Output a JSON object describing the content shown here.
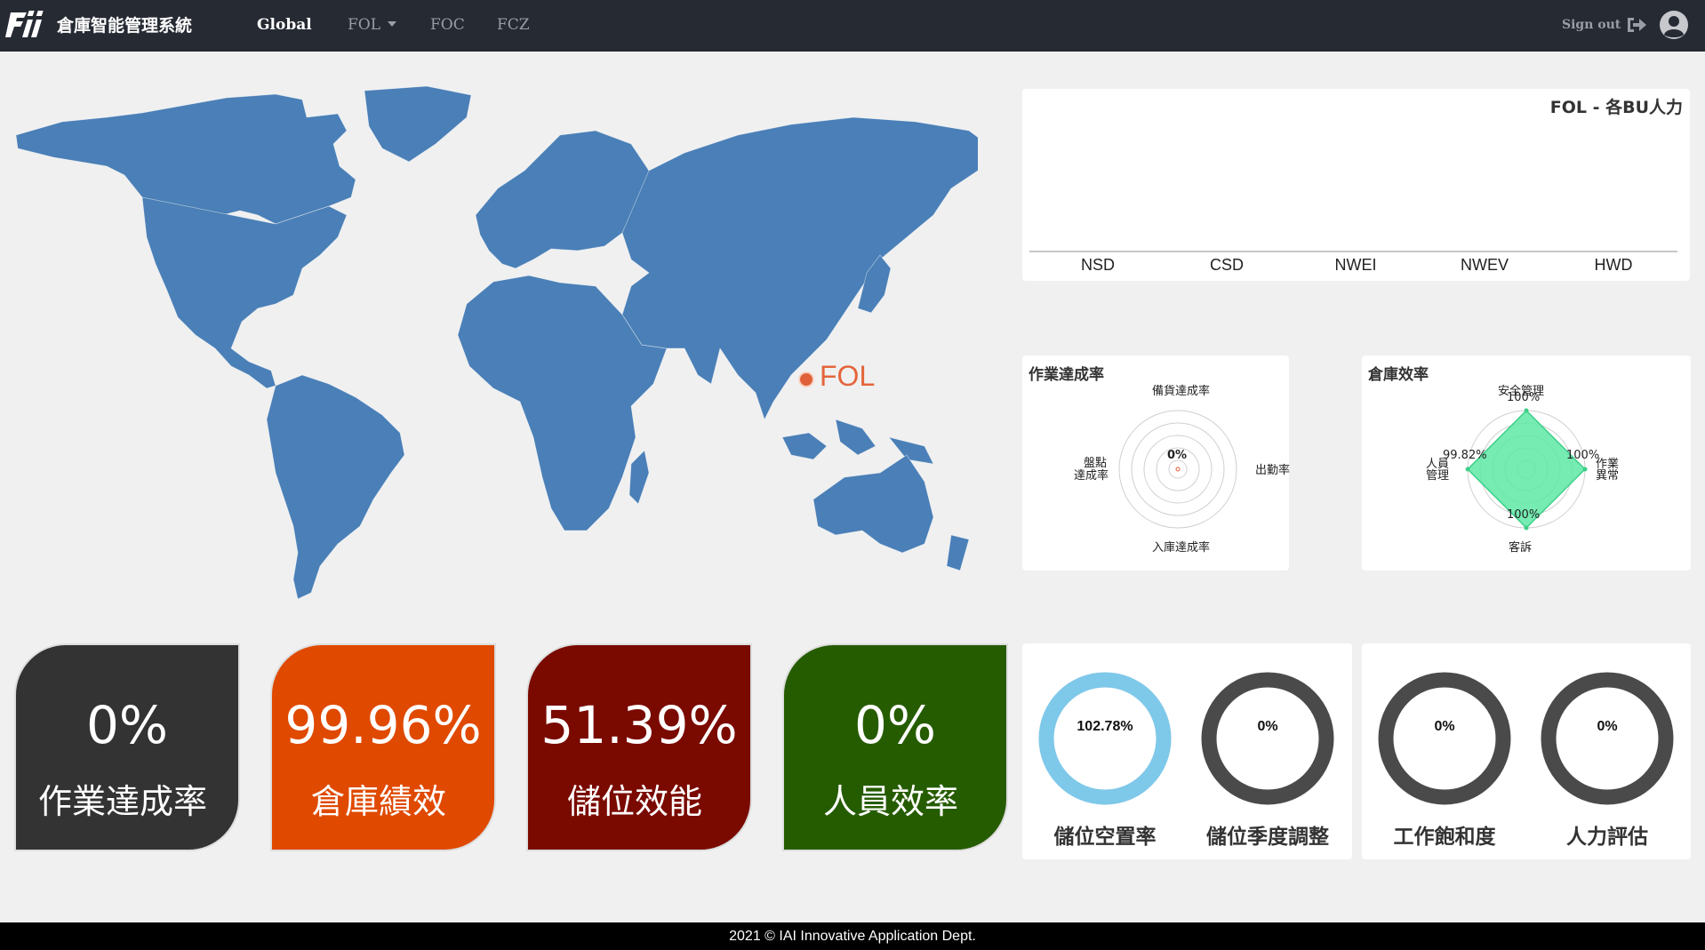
{
  "app": {
    "title": "倉庫智能管理系統"
  },
  "nav": {
    "items": [
      {
        "label": "Global"
      },
      {
        "label": "FOL"
      },
      {
        "label": "FOC"
      },
      {
        "label": "FCZ"
      }
    ],
    "signout_label": "Sign out"
  },
  "map": {
    "marker_label": "FOL",
    "marker_color": "#e0603a",
    "land_color": "#4a7fb7"
  },
  "bar_chart": {
    "title": "FOL - 各BU人力",
    "categories": [
      "NSD",
      "CSD",
      "NWEI",
      "NWEV",
      "HWD"
    ],
    "values": [
      0,
      0,
      0,
      0,
      0
    ]
  },
  "radar_left": {
    "title": "作業達成率",
    "axes": [
      "備貨達成率",
      "出勤率",
      "入庫達成率",
      "盤點達成率"
    ],
    "axis_lines": {
      "left_1": "盤點",
      "left_2": "達成率"
    },
    "center_value": "0%"
  },
  "radar_right": {
    "title": "倉庫效率",
    "axes": [
      "安全管理",
      "作業異常",
      "客訴",
      "人員管理"
    ],
    "axis_lines": {
      "right_1": "作業",
      "right_2": "異常",
      "left_1": "人員",
      "left_2": "管理"
    },
    "values": [
      "100%",
      "100%",
      "100%",
      "99.82%"
    ],
    "fill_color": "#5ee8a5"
  },
  "kpis": [
    {
      "value": "0%",
      "label": "作業達成率",
      "color": "#333333"
    },
    {
      "value": "99.96%",
      "label": "倉庫績效",
      "color": "#e04900"
    },
    {
      "value": "51.39%",
      "label": "儲位效能",
      "color": "#7a0a00"
    },
    {
      "value": "0%",
      "label": "人員效率",
      "color": "#265c00"
    }
  ],
  "donuts": [
    {
      "value": "102.78%",
      "label": "儲位空置率",
      "color": "#7ec8ea",
      "fraction": 1.0
    },
    {
      "value": "0%",
      "label": "儲位季度調整",
      "color": "#4a4a4a",
      "fraction": 0
    },
    {
      "value": "0%",
      "label": "工作飽和度",
      "color": "#4a4a4a",
      "fraction": 0
    },
    {
      "value": "0%",
      "label": "人力評估",
      "color": "#4a4a4a",
      "fraction": 0
    }
  ],
  "footer": {
    "text": "2021 © IAI Innovative Application Dept."
  }
}
